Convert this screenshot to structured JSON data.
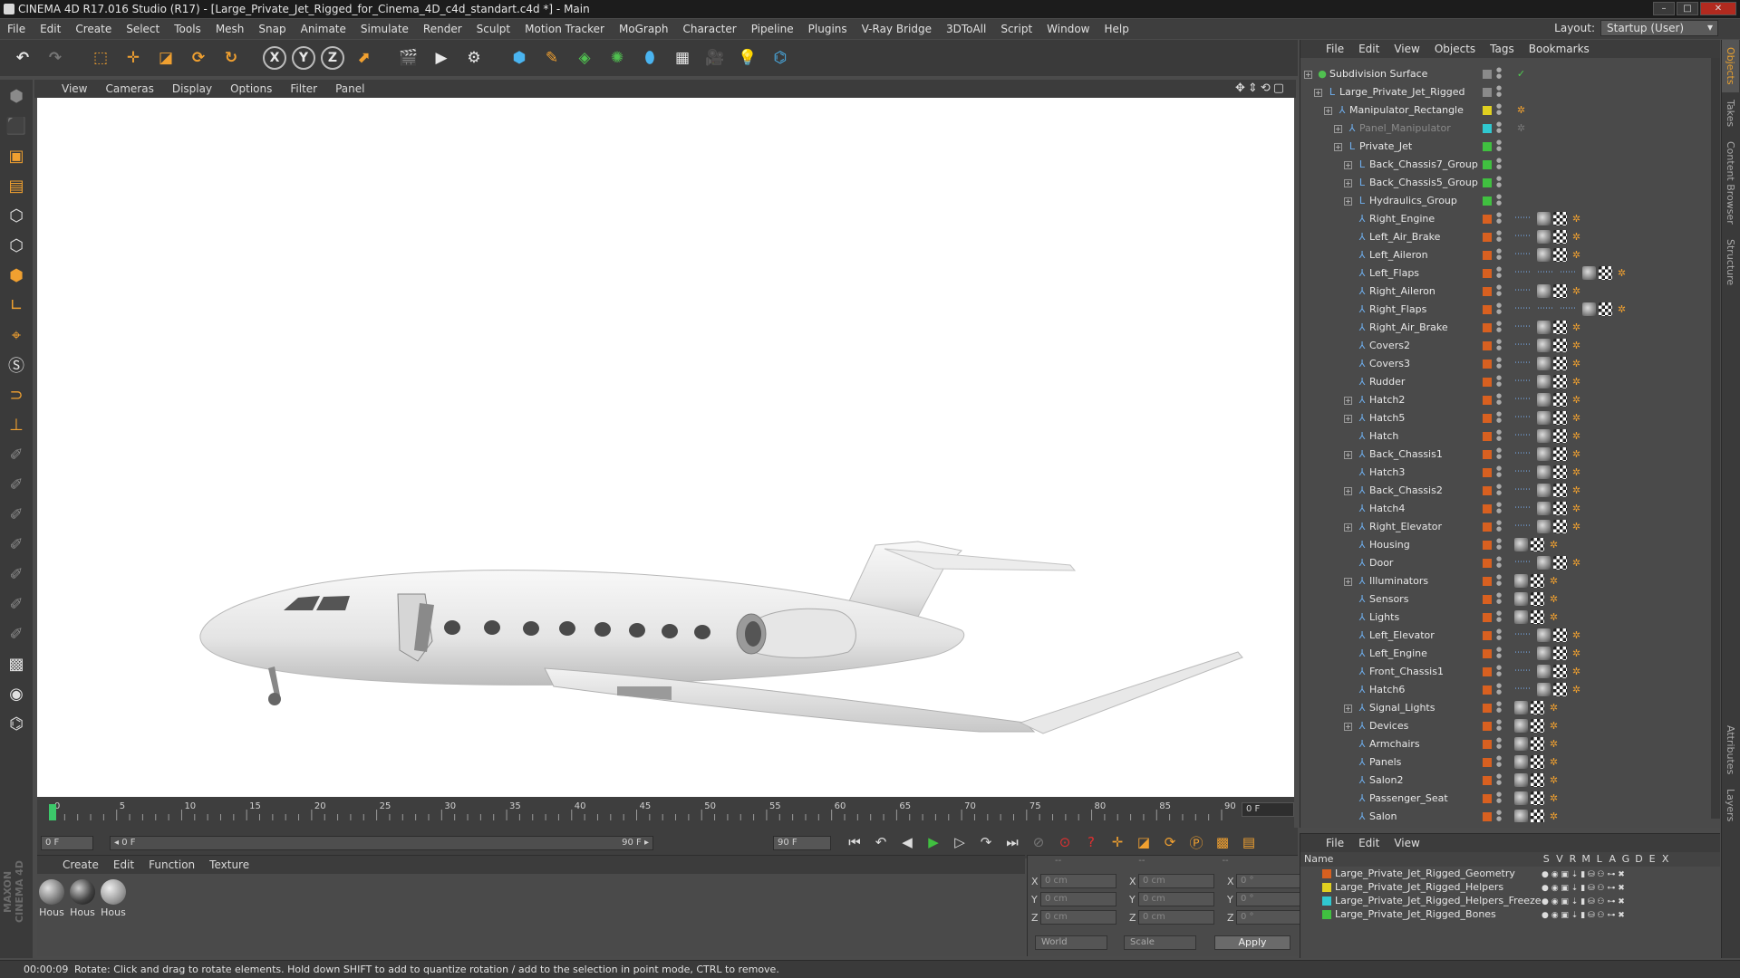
{
  "titlebar": {
    "title": "CINEMA 4D R17.016 Studio (R17) - [Large_Private_Jet_Rigged_for_Cinema_4D_c4d_standart.c4d *] - Main"
  },
  "menubar": [
    "File",
    "Edit",
    "Create",
    "Select",
    "Tools",
    "Mesh",
    "Snap",
    "Animate",
    "Simulate",
    "Render",
    "Sculpt",
    "Motion Tracker",
    "MoGraph",
    "Character",
    "Pipeline",
    "Plugins",
    "V-Ray Bridge",
    "3DToAll",
    "Script",
    "Window",
    "Help"
  ],
  "layout": {
    "label": "Layout:",
    "value": "Startup (User)"
  },
  "viewport": {
    "menu": [
      "View",
      "Cameras",
      "Display",
      "Options",
      "Filter",
      "Panel"
    ]
  },
  "timeline": {
    "ticks": [
      "0",
      "5",
      "10",
      "15",
      "20",
      "25",
      "30",
      "35",
      "40",
      "45",
      "50",
      "55",
      "60",
      "65",
      "70",
      "75",
      "80",
      "85",
      "90"
    ],
    "current_frame_box": "0 F",
    "start_field": "0 F",
    "range_start": "◂ 0 F",
    "range_end": "90 F ▸",
    "end_field": "90 F"
  },
  "material_manager": {
    "menu": [
      "Create",
      "Edit",
      "Function",
      "Texture"
    ],
    "materials": [
      "Hous",
      "Hous",
      "Hous"
    ]
  },
  "coords": {
    "headers": [
      "--",
      "--",
      "--"
    ],
    "rows": [
      {
        "l1": "X",
        "v1": "0 cm",
        "l2": "X",
        "v2": "0 cm",
        "l3": "X",
        "v3": "0 °"
      },
      {
        "l1": "Y",
        "v1": "0 cm",
        "l2": "Y",
        "v2": "0 cm",
        "l3": "Y",
        "v3": "0 °"
      },
      {
        "l1": "Z",
        "v1": "0 cm",
        "l2": "Z",
        "v2": "0 cm",
        "l3": "Z",
        "v3": "0 °"
      }
    ],
    "mode": "World",
    "transform": "Scale",
    "apply": "Apply"
  },
  "object_manager": {
    "menu": [
      "File",
      "Edit",
      "View",
      "Objects",
      "Tags",
      "Bookmarks"
    ],
    "objects": [
      {
        "name": "Subdivision Surface",
        "indent": 0,
        "color": "#8a8a8a",
        "icon": "subdivision-icon"
      },
      {
        "name": "Large_Private_Jet_Rigged",
        "indent": 1,
        "color": "#8a8a8a",
        "icon": "null-icon"
      },
      {
        "name": "Manipulator_Rectangle",
        "indent": 2,
        "color": "#e0d020",
        "icon": "bone-icon"
      },
      {
        "name": "Panel_Manipulator",
        "indent": 3,
        "color": "#30c8d0",
        "icon": "bone-icon",
        "dim": true
      },
      {
        "name": "Private_Jet",
        "indent": 3,
        "color": "#40c040",
        "icon": "null-icon"
      },
      {
        "name": "Back_Chassis7_Group",
        "indent": 4,
        "color": "#40c040",
        "icon": "null-icon"
      },
      {
        "name": "Back_Chassis5_Group",
        "indent": 4,
        "color": "#40c040",
        "icon": "null-icon"
      },
      {
        "name": "Hydraulics_Group",
        "indent": 4,
        "color": "#40c040",
        "icon": "null-icon"
      },
      {
        "name": "Right_Engine",
        "indent": 4,
        "color": "#d86020",
        "icon": "bone-icon"
      },
      {
        "name": "Left_Air_Brake",
        "indent": 4,
        "color": "#d86020",
        "icon": "bone-icon"
      },
      {
        "name": "Left_Aileron",
        "indent": 4,
        "color": "#d86020",
        "icon": "bone-icon"
      },
      {
        "name": "Left_Flaps",
        "indent": 4,
        "color": "#d86020",
        "icon": "bone-icon"
      },
      {
        "name": "Right_Aileron",
        "indent": 4,
        "color": "#d86020",
        "icon": "bone-icon"
      },
      {
        "name": "Right_Flaps",
        "indent": 4,
        "color": "#d86020",
        "icon": "bone-icon"
      },
      {
        "name": "Right_Air_Brake",
        "indent": 4,
        "color": "#d86020",
        "icon": "bone-icon"
      },
      {
        "name": "Covers2",
        "indent": 4,
        "color": "#d86020",
        "icon": "bone-icon"
      },
      {
        "name": "Covers3",
        "indent": 4,
        "color": "#d86020",
        "icon": "bone-icon"
      },
      {
        "name": "Rudder",
        "indent": 4,
        "color": "#d86020",
        "icon": "bone-icon"
      },
      {
        "name": "Hatch2",
        "indent": 4,
        "color": "#d86020",
        "icon": "bone-icon"
      },
      {
        "name": "Hatch5",
        "indent": 4,
        "color": "#d86020",
        "icon": "bone-icon"
      },
      {
        "name": "Hatch",
        "indent": 4,
        "color": "#d86020",
        "icon": "bone-icon"
      },
      {
        "name": "Back_Chassis1",
        "indent": 4,
        "color": "#d86020",
        "icon": "bone-icon"
      },
      {
        "name": "Hatch3",
        "indent": 4,
        "color": "#d86020",
        "icon": "bone-icon"
      },
      {
        "name": "Back_Chassis2",
        "indent": 4,
        "color": "#d86020",
        "icon": "bone-icon"
      },
      {
        "name": "Hatch4",
        "indent": 4,
        "color": "#d86020",
        "icon": "bone-icon"
      },
      {
        "name": "Right_Elevator",
        "indent": 4,
        "color": "#d86020",
        "icon": "bone-icon"
      },
      {
        "name": "Housing",
        "indent": 4,
        "color": "#d86020",
        "icon": "bone-icon"
      },
      {
        "name": "Door",
        "indent": 4,
        "color": "#d86020",
        "icon": "bone-icon"
      },
      {
        "name": "Illuminators",
        "indent": 4,
        "color": "#d86020",
        "icon": "bone-icon"
      },
      {
        "name": "Sensors",
        "indent": 4,
        "color": "#d86020",
        "icon": "bone-icon"
      },
      {
        "name": "Lights",
        "indent": 4,
        "color": "#d86020",
        "icon": "bone-icon"
      },
      {
        "name": "Left_Elevator",
        "indent": 4,
        "color": "#d86020",
        "icon": "bone-icon"
      },
      {
        "name": "Left_Engine",
        "indent": 4,
        "color": "#d86020",
        "icon": "bone-icon"
      },
      {
        "name": "Front_Chassis1",
        "indent": 4,
        "color": "#d86020",
        "icon": "bone-icon"
      },
      {
        "name": "Hatch6",
        "indent": 4,
        "color": "#d86020",
        "icon": "bone-icon"
      },
      {
        "name": "Signal_Lights",
        "indent": 4,
        "color": "#d86020",
        "icon": "bone-icon"
      },
      {
        "name": "Devices",
        "indent": 4,
        "color": "#d86020",
        "icon": "bone-icon"
      },
      {
        "name": "Armchairs",
        "indent": 4,
        "color": "#d86020",
        "icon": "bone-icon"
      },
      {
        "name": "Panels",
        "indent": 4,
        "color": "#d86020",
        "icon": "bone-icon"
      },
      {
        "name": "Salon2",
        "indent": 4,
        "color": "#d86020",
        "icon": "bone-icon"
      },
      {
        "name": "Passenger_Seat",
        "indent": 4,
        "color": "#d86020",
        "icon": "bone-icon"
      },
      {
        "name": "Salon",
        "indent": 4,
        "color": "#d86020",
        "icon": "bone-icon"
      }
    ]
  },
  "layer_manager": {
    "menu": [
      "File",
      "Edit",
      "View"
    ],
    "name_header": "Name",
    "columns": [
      "S",
      "V",
      "R",
      "M",
      "L",
      "A",
      "G",
      "D",
      "E",
      "X"
    ],
    "layers": [
      {
        "name": "Large_Private_Jet_Rigged_Geometry",
        "color": "#d86020"
      },
      {
        "name": "Large_Private_Jet_Rigged_Helpers",
        "color": "#e0d020"
      },
      {
        "name": "Large_Private_Jet_Rigged_Helpers_Freeze",
        "color": "#30c8d0"
      },
      {
        "name": "Large_Private_Jet_Rigged_Bones",
        "color": "#40c040"
      }
    ]
  },
  "right_tabs": [
    "Objects",
    "Takes",
    "Content Browser",
    "Structure",
    "Attributes",
    "Layers"
  ],
  "status": {
    "time": "00:00:09",
    "message": "Rotate: Click and drag to rotate elements. Hold down SHIFT to add to quantize rotation / add to the selection in point mode, CTRL to remove."
  },
  "branding": "MAXON CINEMA 4D"
}
